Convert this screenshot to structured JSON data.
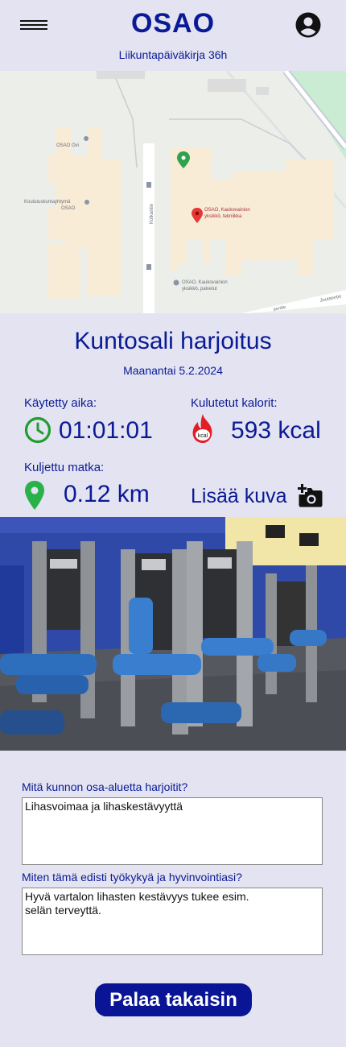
{
  "header": {
    "logo": "OSAO",
    "subtitle": "Liikuntapäiväkirja 36h",
    "menu_icon": "hamburger-menu-icon",
    "profile_icon": "account-circle-icon"
  },
  "map": {
    "labels": {
      "osao_ovi": "OSAO Ovi",
      "koulutus_1": "Koulutuskuntayhtymä",
      "koulutus_2": "OSAO",
      "road": "Kotkantie",
      "kauko_1": "OSAO, Kaukovainion",
      "kauko_2": "yksikkö, tekniikka",
      "palvelut_1": "OSAO, Kaukovainion",
      "palvelut_2": "yksikkö, palvelut",
      "joutsentie": "Joutsentie",
      "senpie": "sentie"
    }
  },
  "workout": {
    "title": "Kuntosali harjoitus",
    "date": "Maanantai 5.2.2024"
  },
  "stats": {
    "time_label": "Käytetty aika:",
    "time_value": "01:01:01",
    "calories_label": "Kulutetut kalorit:",
    "calories_value": "593 kcal",
    "calories_icon_text": "kcal",
    "distance_label": "Kuljettu matka:",
    "distance_value": "0.12 km",
    "add_photo_label": "Lisää kuva"
  },
  "colors": {
    "accent": "#0a1a96",
    "clock_green": "#1e9e2e",
    "pin_green": "#29b14a",
    "flame_red": "#e31d24",
    "button_bg": "#0a1596"
  },
  "questions": {
    "q1_label": "Mitä kunnon osa-aluetta harjoitit?",
    "q1_value": "Lihasvoimaa ja lihaskestävyyttä",
    "q2_label": "Miten tämä edisti työkykyä ja hyvinvointiasi?",
    "q2_value": "Hyvä vartalon lihasten kestävyys tukee esim.\nselän terveyttä."
  },
  "actions": {
    "back_label": "Palaa takaisin"
  }
}
